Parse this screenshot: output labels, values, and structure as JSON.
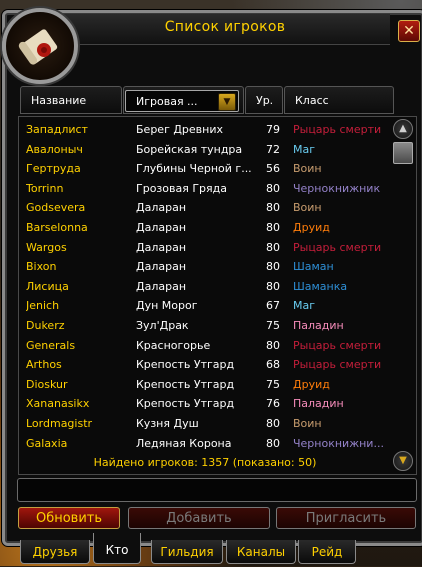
{
  "window": {
    "title": "Список игроков",
    "close_label": "✕"
  },
  "columns": {
    "name": "Название",
    "zone": "Игровая ...",
    "level": "Ур.",
    "class": "Класс"
  },
  "class_colors": {
    "Рыцарь смерти": "#c41e3a",
    "Маг": "#69ccf0",
    "Воин": "#c79c6e",
    "Чернокнижник": "#9482c9",
    "Друид": "#ff7d0a",
    "Шаман": "#2e8fd6",
    "Шаманка": "#2e8fd6",
    "Паладин": "#f58cba"
  },
  "players": [
    {
      "name": "Западлист",
      "zone": "Берег Древних",
      "level": "79",
      "class": "Рыцарь смерти"
    },
    {
      "name": "Авалоныч",
      "zone": "Борейская тундра",
      "level": "72",
      "class": "Маг"
    },
    {
      "name": "Гертруда",
      "zone": "Глубины Черной г...",
      "level": "56",
      "class": "Воин"
    },
    {
      "name": "Torrinn",
      "zone": "Грозовая Гряда",
      "level": "80",
      "class": "Чернокнижник"
    },
    {
      "name": "Godsevera",
      "zone": "Даларан",
      "level": "80",
      "class": "Воин"
    },
    {
      "name": "Barselonna",
      "zone": "Даларан",
      "level": "80",
      "class": "Друид"
    },
    {
      "name": "Wargos",
      "zone": "Даларан",
      "level": "80",
      "class": "Рыцарь смерти"
    },
    {
      "name": "Bixon",
      "zone": "Даларан",
      "level": "80",
      "class": "Шаман"
    },
    {
      "name": "Лисица",
      "zone": "Даларан",
      "level": "80",
      "class": "Шаманка"
    },
    {
      "name": "Jenich",
      "zone": "Дун Морог",
      "level": "67",
      "class": "Маг"
    },
    {
      "name": "Dukerz",
      "zone": "Зул'Драк",
      "level": "75",
      "class": "Паладин"
    },
    {
      "name": "Generals",
      "zone": "Красногорье",
      "level": "80",
      "class": "Рыцарь смерти"
    },
    {
      "name": "Arthos",
      "zone": "Крепость Утгард",
      "level": "68",
      "class": "Рыцарь смерти"
    },
    {
      "name": "Dioskur",
      "zone": "Крепость Утгард",
      "level": "75",
      "class": "Друид"
    },
    {
      "name": "Xananasikx",
      "zone": "Крепость Утгард",
      "level": "76",
      "class": "Паладин"
    },
    {
      "name": "Lordmagistr",
      "zone": "Кузня Душ",
      "level": "80",
      "class": "Воин"
    },
    {
      "name": "Galaxia",
      "zone": "Ледяная Корона",
      "level": "80",
      "class": "Чернокнижни..."
    }
  ],
  "footer": {
    "found_text": "Найдено игроков: 1357  (показано: 50)"
  },
  "buttons": {
    "refresh": "Обновить",
    "add": "Добавить",
    "invite": "Пригласить"
  },
  "tabs": [
    "Друзья",
    "Кто",
    "Гильдия",
    "Каналы",
    "Рейд"
  ],
  "active_tab": "Кто"
}
